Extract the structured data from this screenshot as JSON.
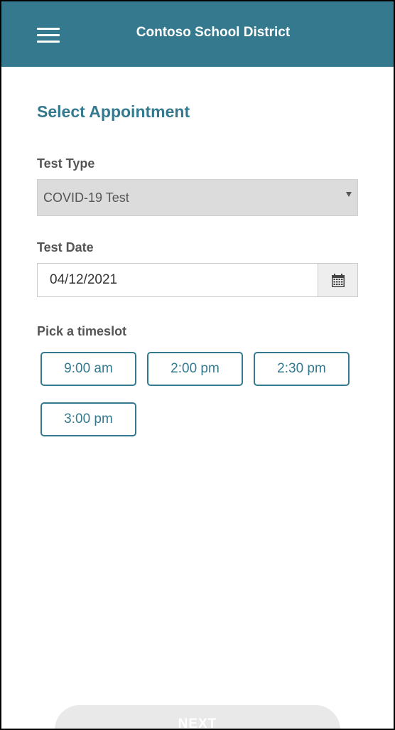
{
  "header": {
    "title": "Contoso School District",
    "menu_icon": "hamburger-menu-icon",
    "background_color": "#35798e"
  },
  "page": {
    "title": "Select Appointment"
  },
  "test_type": {
    "label": "Test Type",
    "selected_value": "COVID-19 Test",
    "caret_icon": "caret-down-icon"
  },
  "test_date": {
    "label": "Test Date",
    "value": "04/12/2021",
    "calendar_icon": "calendar-icon"
  },
  "timeslots": {
    "label": "Pick a timeslot",
    "slots": [
      "9:00 am",
      "2:00 pm",
      "2:30 pm",
      "3:00 pm"
    ]
  },
  "footer": {
    "next_label": "NEXT"
  },
  "colors": {
    "accent": "#35798e",
    "label_text": "#555555",
    "select_bg": "#dcdcdc",
    "disabled_button": "#e9e9e9"
  }
}
